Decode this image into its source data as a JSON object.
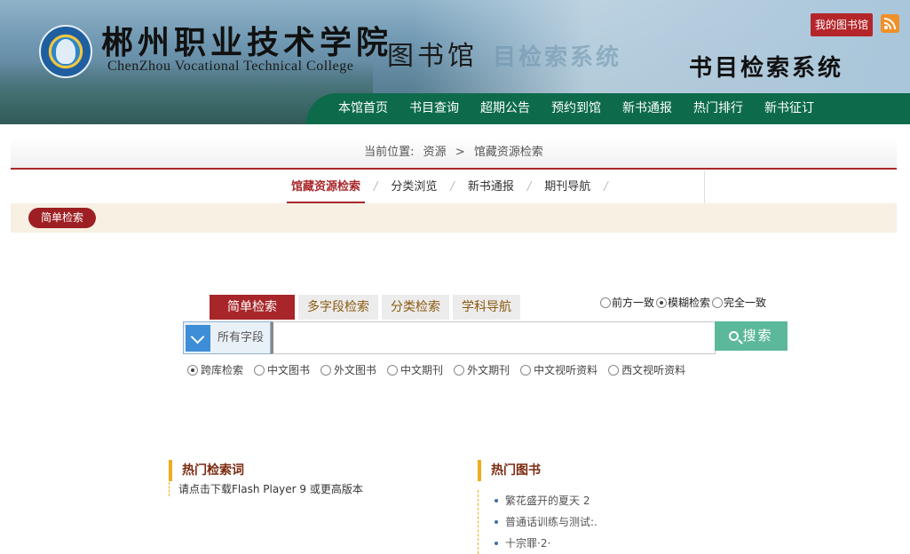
{
  "header": {
    "college_cn": "郴州职业技术学院",
    "college_en": "ChenZhou Vocational Technical College",
    "library_cn": "图书馆",
    "ghost_title": "目检索系统",
    "system_title": "书目检索系统",
    "my_library": "我的图书馆",
    "rss_icon": "rss-icon"
  },
  "nav": {
    "items": [
      "本馆首页",
      "书目查询",
      "超期公告",
      "预约到馆",
      "新书通报",
      "热门排行",
      "新书征订"
    ]
  },
  "breadcrumb": {
    "prefix": "当前位置:",
    "level1": "资源",
    "separator": ">",
    "level2": "馆藏资源检索"
  },
  "tabs": [
    "馆藏资源检索",
    "分类浏览",
    "新书通报",
    "期刊导航"
  ],
  "subbar": {
    "pill": "简单检索"
  },
  "search": {
    "tabs": [
      "简单检索",
      "多字段检索",
      "分类检索",
      "学科导航"
    ],
    "match_options": [
      {
        "label": "前方一致",
        "selected": false
      },
      {
        "label": "模糊检索",
        "selected": true
      },
      {
        "label": "完全一致",
        "selected": false
      }
    ],
    "field": "所有字段",
    "input_value": "",
    "button": "搜索",
    "databases": [
      {
        "label": "跨库检索",
        "selected": true
      },
      {
        "label": "中文图书",
        "selected": false
      },
      {
        "label": "外文图书",
        "selected": false
      },
      {
        "label": "中文期刊",
        "selected": false
      },
      {
        "label": "外文期刊",
        "selected": false
      },
      {
        "label": "中文视听资料",
        "selected": false
      },
      {
        "label": "西文视听资料",
        "selected": false
      }
    ]
  },
  "hot_terms": {
    "title": "热门检索词",
    "notice": "请点击下载Flash Player 9 或更高版本"
  },
  "hot_books": {
    "title": "热门图书",
    "items": [
      "繁花盛开的夏天 2",
      "普通话训练与测试:.",
      "十宗罪·2·"
    ]
  },
  "colors": {
    "nav_green": "#0d6b4b",
    "brand_red": "#a8262a",
    "search_green": "#5cb89a",
    "accent_orange": "#f0ac1e"
  }
}
